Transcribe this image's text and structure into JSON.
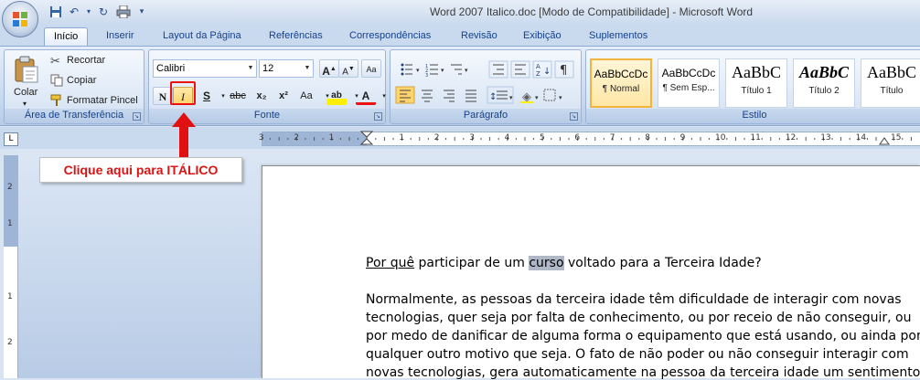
{
  "window": {
    "title": "Word 2007 Italico.doc [Modo de Compatibilidade] - Microsoft Word"
  },
  "tabs": [
    "Início",
    "Inserir",
    "Layout da Página",
    "Referências",
    "Correspondências",
    "Revisão",
    "Exibição",
    "Suplementos"
  ],
  "clipboard": {
    "paste_label": "Colar",
    "cut_label": "Recortar",
    "copy_label": "Copiar",
    "format_painter_label": "Formatar Pincel",
    "group_label": "Área de Transferência"
  },
  "font": {
    "font_name": "Calibri",
    "font_size": "12",
    "bold": "N",
    "italic": "I",
    "underline": "S",
    "strike": "abc",
    "subscript": "x₂",
    "superscript": "x²",
    "change_case": "Aa",
    "highlight": "ab",
    "font_color": "A",
    "group_label": "Fonte"
  },
  "paragraph": {
    "group_label": "Parágrafo"
  },
  "styles": {
    "group_label": "Estilo",
    "items": [
      {
        "sample": "AaBbCcDc",
        "name": "¶ Normal"
      },
      {
        "sample": "AaBbCcDc",
        "name": "¶ Sem Esp..."
      },
      {
        "sample": "AaBbC",
        "name": "Título 1"
      },
      {
        "sample": "AaBbC",
        "name": "Título 2"
      },
      {
        "sample": "AaBbC",
        "name": "Título"
      }
    ]
  },
  "ruler": {
    "h_numbers": [
      "3",
      "2",
      "1",
      "1",
      "2",
      "3",
      "4",
      "5",
      "6",
      "7",
      "8",
      "9",
      "10",
      "11",
      "12",
      "13",
      "14",
      "15"
    ],
    "v_numbers": [
      "2",
      "1",
      "1",
      "2"
    ]
  },
  "annotation": {
    "callout_text": "Clique aqui para ITÁLICO"
  },
  "document": {
    "line1_pre": "Por quê",
    "line1_mid1": " participar de um ",
    "line1_selected": "curso",
    "line1_post": " voltado para a Terceira Idade?",
    "para_lines": [
      "Normalmente, as pessoas da terceira idade têm dificuldade de interagir com novas",
      "tecnologias, quer seja por falta de conhecimento, ou por receio de não conseguir, ou",
      "por medo de danificar de alguma forma o equipamento que está usando,  ou ainda por",
      "qualquer outro motivo que seja. O fato de não poder ou não conseguir interagir com",
      "novas tecnologias, gera automaticamente na pessoa da terceira idade um sentimento"
    ]
  },
  "colors": {
    "accent": "#15428b",
    "annotation_red": "#e11111"
  }
}
